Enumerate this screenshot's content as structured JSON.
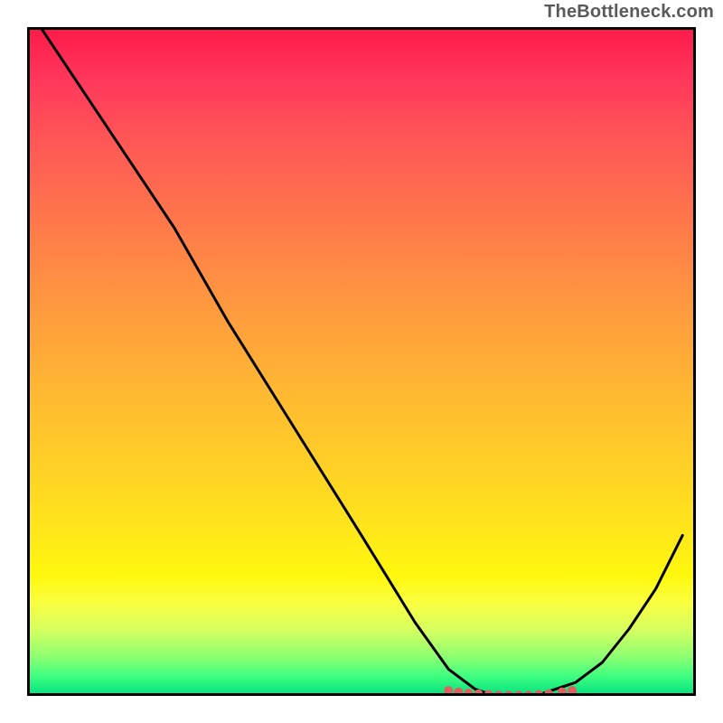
{
  "watermark": "TheBottleneck.com",
  "chart_data": {
    "type": "line",
    "title": "",
    "xlabel": "",
    "ylabel": "",
    "xlim": [
      0,
      100
    ],
    "ylim": [
      0,
      100
    ],
    "grid": false,
    "series": [
      {
        "name": "curve",
        "color": "#000000",
        "x": [
          2,
          10,
          18,
          22,
          30,
          40,
          50,
          58,
          63,
          67,
          70,
          73,
          76,
          79,
          82,
          86,
          90,
          94,
          98
        ],
        "values": [
          100,
          88,
          76,
          70,
          56,
          40,
          24,
          11,
          4,
          1,
          0,
          0,
          0,
          1,
          2,
          5,
          10,
          16,
          24
        ]
      },
      {
        "name": "dots",
        "color": "#e06060",
        "type": "scatter",
        "x": [
          63,
          64.5,
          66,
          67.5,
          69,
          70.5,
          72,
          73.5,
          75,
          76.5,
          78,
          80,
          81.5
        ],
        "values": [
          0.8,
          0.6,
          0.4,
          0.3,
          0.2,
          0.1,
          0.1,
          0.1,
          0.1,
          0.2,
          0.3,
          0.6,
          0.8
        ]
      }
    ]
  }
}
